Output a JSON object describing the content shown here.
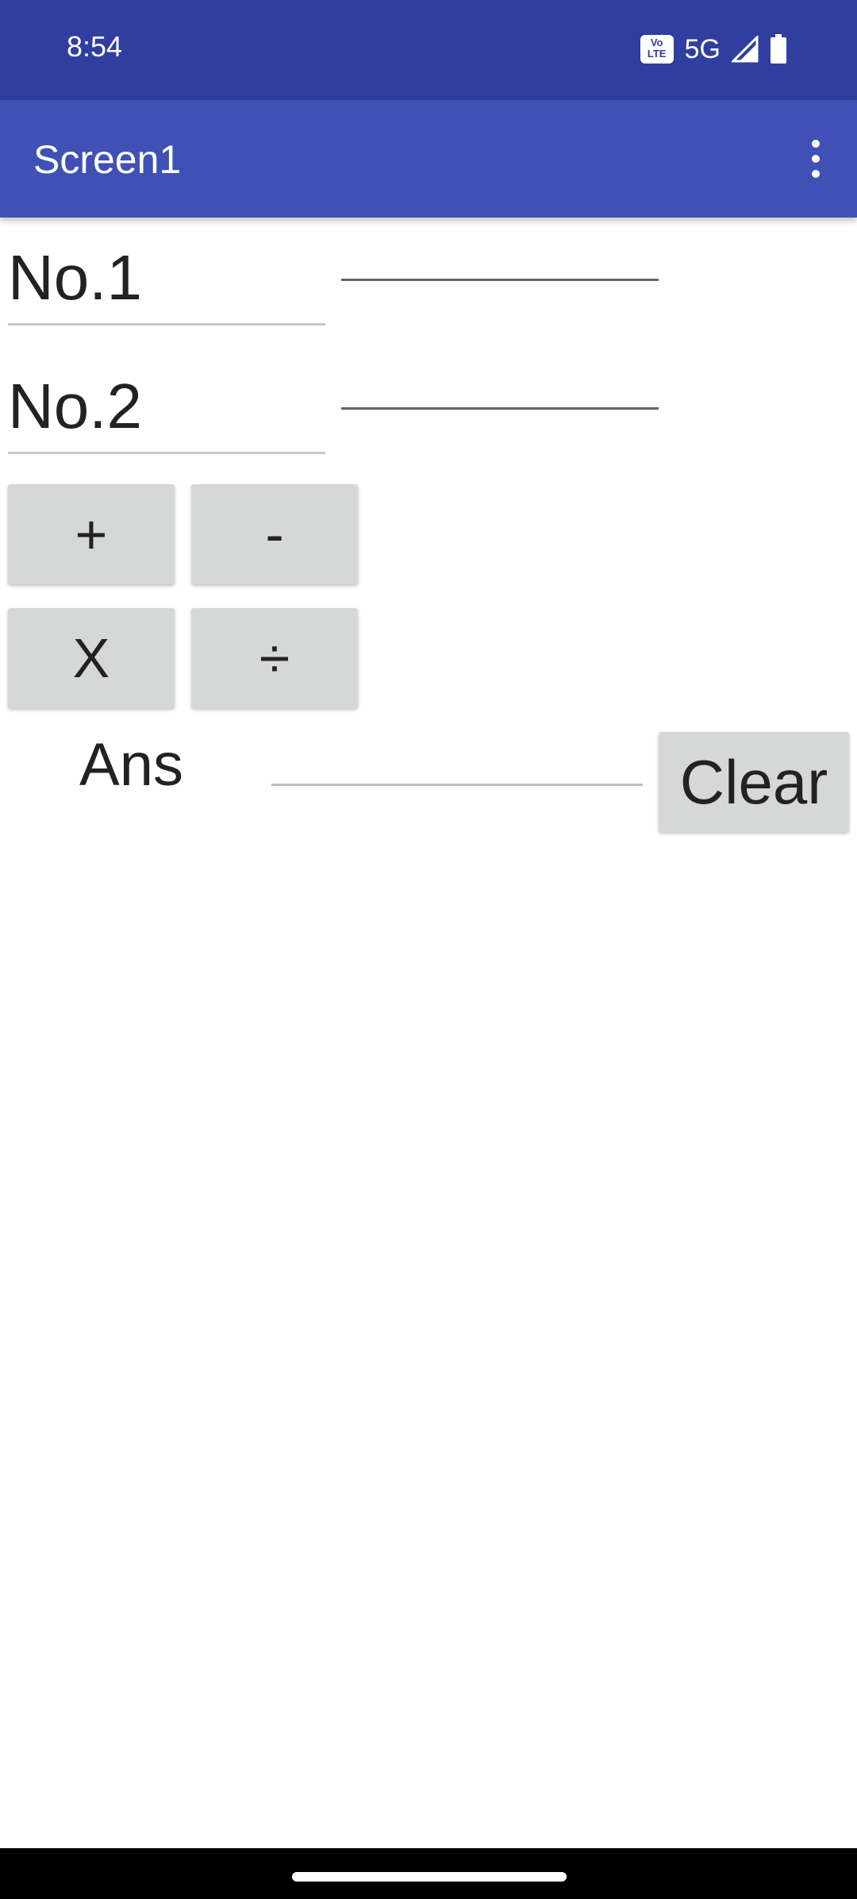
{
  "status_bar": {
    "time": "8:54",
    "volte_label": "Vo\nLTE",
    "network": "5G",
    "icons": [
      "volte-icon",
      "signal-icon",
      "battery-icon"
    ]
  },
  "app_bar": {
    "title": "Screen1",
    "menu_icon": "overflow-menu-icon"
  },
  "form": {
    "no1_label": "No.1",
    "no1_value": "",
    "no2_label": "No.2",
    "no2_value": ""
  },
  "operators": {
    "add": "+",
    "subtract": "-",
    "multiply": "X",
    "divide": "÷"
  },
  "answer": {
    "label": "Ans",
    "value": "",
    "clear_label": "Clear"
  },
  "colors": {
    "status_bar": "#303f9f",
    "app_bar": "#3f51b5",
    "button": "#d6d7d7"
  }
}
